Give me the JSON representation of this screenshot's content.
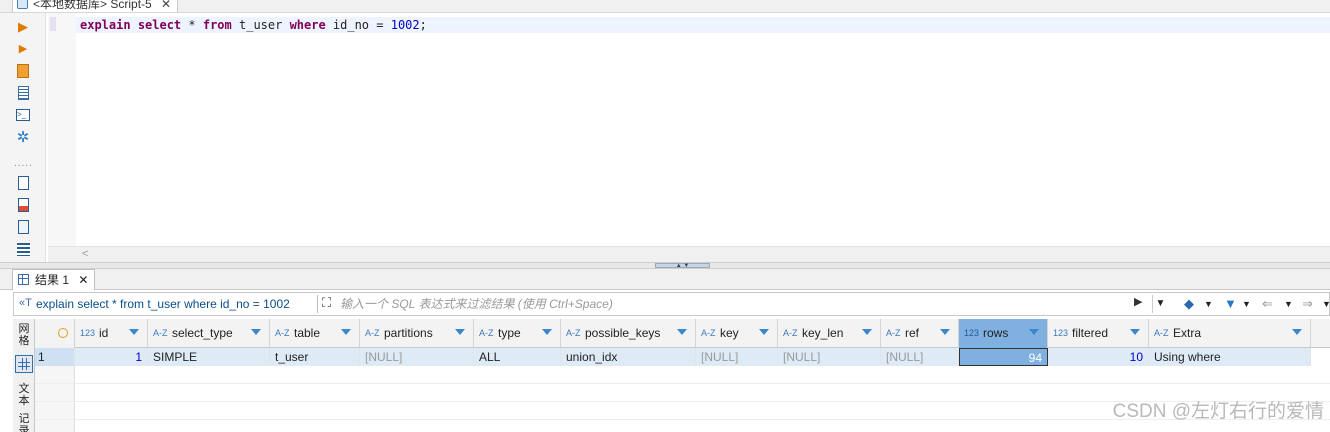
{
  "editor_tab": {
    "title": "<本地数据库> Script-5",
    "close": "✕"
  },
  "editor": {
    "sql_tokens": [
      {
        "text": "explain",
        "kind": "kw"
      },
      {
        "text": " ",
        "kind": "plain"
      },
      {
        "text": "select",
        "kind": "kw"
      },
      {
        "text": " * ",
        "kind": "plain"
      },
      {
        "text": "from",
        "kind": "kw"
      },
      {
        "text": " t_user ",
        "kind": "plain"
      },
      {
        "text": "where",
        "kind": "kw"
      },
      {
        "text": " id_no = ",
        "kind": "plain"
      },
      {
        "text": "1002",
        "kind": "num"
      },
      {
        "text": ";",
        "kind": "plain"
      }
    ]
  },
  "left_toolbar": {
    "icons": [
      "execute-icon",
      "execute-script-icon",
      "explain-plan-icon",
      "load-plan-icon",
      "console-icon",
      "settings-icon",
      "export-icon",
      "import-icon",
      "save-icon",
      "outline-icon"
    ],
    "more": "....."
  },
  "results_tab": {
    "label": "结果 1",
    "close": "✕"
  },
  "filter": {
    "query": "explain select * from t_user where id_no = 1002",
    "placeholder": "输入一个 SQL 表达式来过滤结果 (使用 Ctrl+Space)"
  },
  "mode_sidebar": {
    "grid_label": "网格",
    "text_label": "文本",
    "record_label": "记录"
  },
  "columns": [
    {
      "type": "123",
      "name": "id"
    },
    {
      "type": "A-Z",
      "name": "select_type"
    },
    {
      "type": "A-Z",
      "name": "table"
    },
    {
      "type": "A-Z",
      "name": "partitions"
    },
    {
      "type": "A-Z",
      "name": "type"
    },
    {
      "type": "A-Z",
      "name": "possible_keys"
    },
    {
      "type": "A-Z",
      "name": "key"
    },
    {
      "type": "A-Z",
      "name": "key_len"
    },
    {
      "type": "A-Z",
      "name": "ref"
    },
    {
      "type": "123",
      "name": "rows"
    },
    {
      "type": "123",
      "name": "filtered"
    },
    {
      "type": "A-Z",
      "name": "Extra"
    }
  ],
  "rows": [
    {
      "row_number": "1",
      "cells": [
        "1",
        "SIMPLE",
        "t_user",
        "[NULL]",
        "ALL",
        "union_idx",
        "[NULL]",
        "[NULL]",
        "[NULL]",
        "94",
        "10",
        "Using where"
      ]
    }
  ],
  "watermark": "CSDN @左灯右行的爱情",
  "colors": {
    "selected_column": "#7fb0e0",
    "row_highlight": "#dfeaf7",
    "keyword": "#7f0055",
    "number": "#0000cc"
  }
}
